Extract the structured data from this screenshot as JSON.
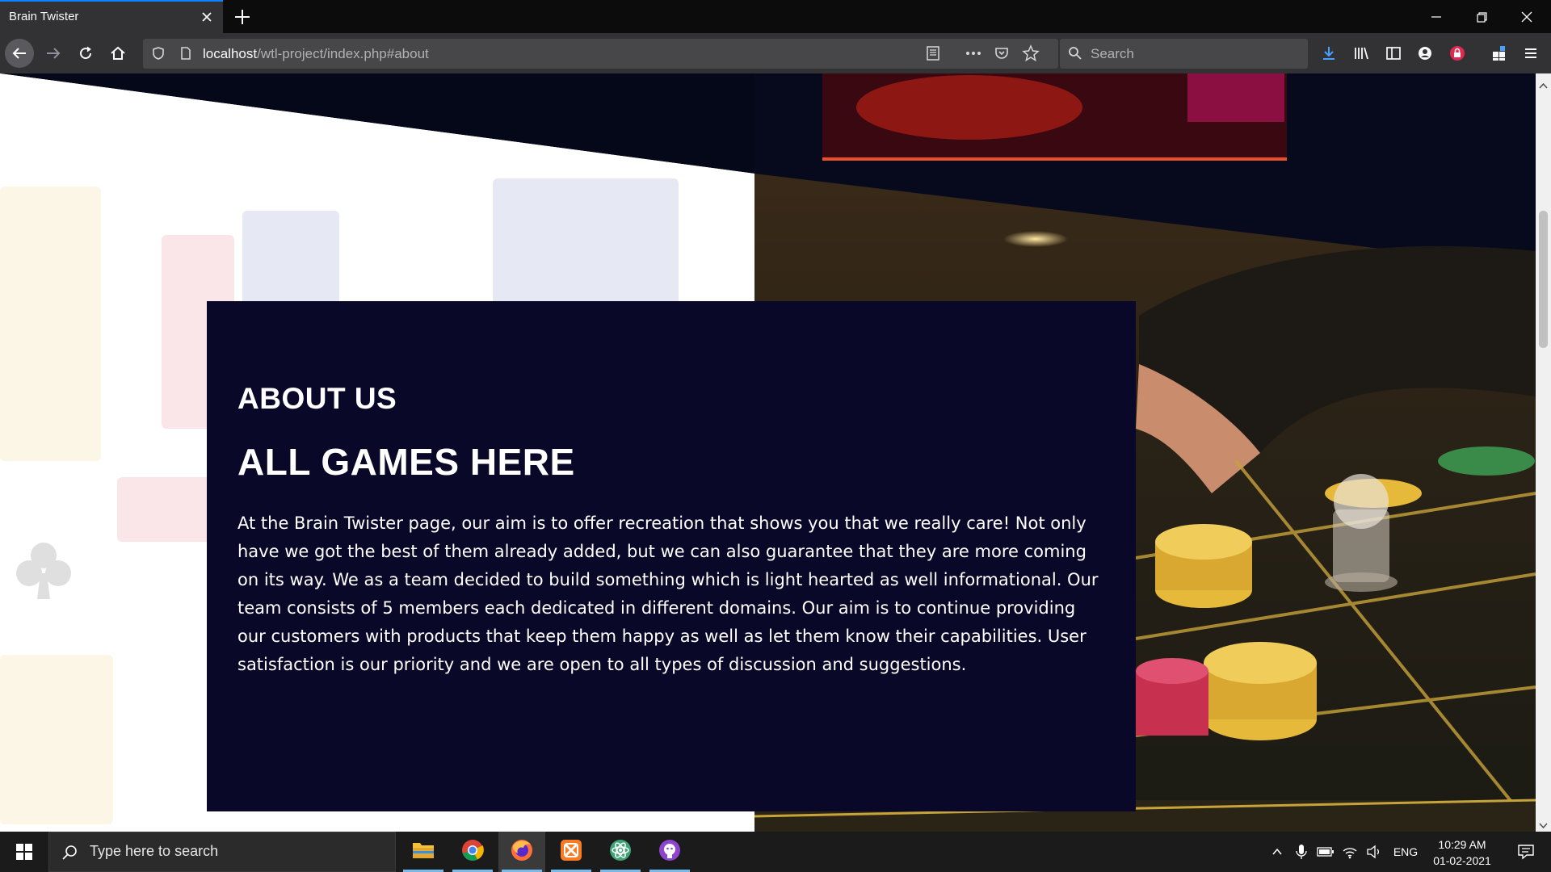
{
  "browser": {
    "tab_title": "Brain Twister",
    "url_host": "localhost",
    "url_path": "/wtl-project/index.php#about",
    "search_placeholder": "Search"
  },
  "about": {
    "heading": "ABOUT US",
    "subheading": "ALL GAMES HERE",
    "body": "At the Brain Twister page, our aim is to offer recreation that shows you that we really care! Not only have we got the best of them already added, but we can also guarantee that they are more coming on its way. We as a team decided to build something which is light hearted as well informational. Our team consists of 5 members each dedicated in different domains. Our aim is to continue providing our customers with products that keep them happy as well as let them know their capabilities. User satisfaction is our priority and we are open to all types of discussion and suggestions."
  },
  "taskbar": {
    "search_placeholder": "Type here to search",
    "language": "ENG",
    "time": "10:29 AM",
    "date": "01-02-2021",
    "apps": [
      "file-explorer",
      "chrome",
      "firefox",
      "xampp",
      "atom",
      "github-desktop"
    ]
  },
  "colors": {
    "card_bg": "#0a0828",
    "accent": "#0a84ff"
  }
}
